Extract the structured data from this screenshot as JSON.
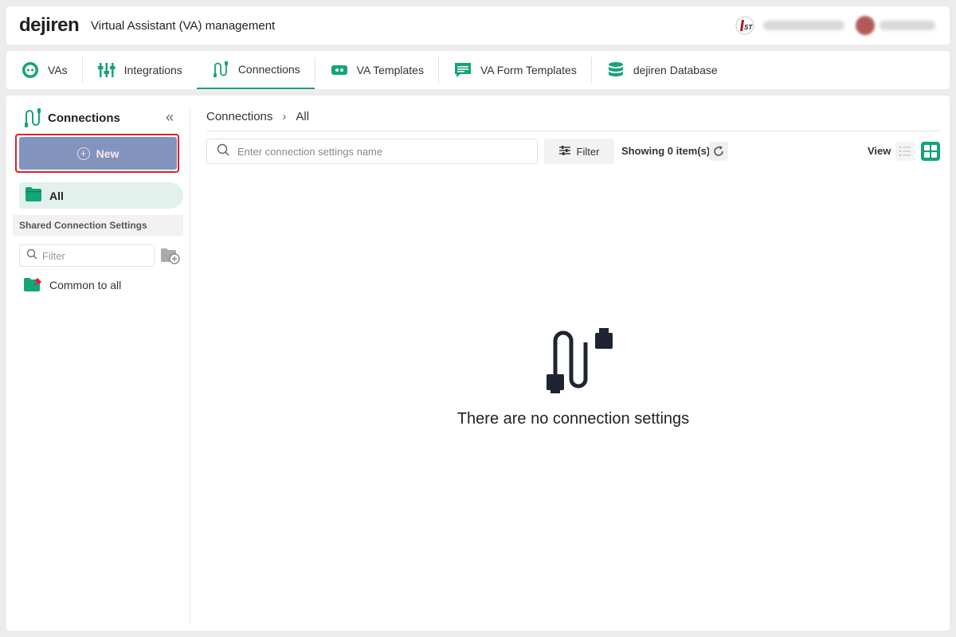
{
  "header": {
    "logo": "dejiren",
    "title": "Virtual Assistant (VA) management"
  },
  "tabs": [
    {
      "label": "VAs",
      "icon": "va-robot-icon"
    },
    {
      "label": "Integrations",
      "icon": "integrations-sliders-icon"
    },
    {
      "label": "Connections",
      "icon": "connections-cable-icon",
      "active": true
    },
    {
      "label": "VA Templates",
      "icon": "va-template-icon"
    },
    {
      "label": "VA Form Templates",
      "icon": "form-template-icon"
    },
    {
      "label": "dejiren Database",
      "icon": "database-icon"
    }
  ],
  "sidebar": {
    "title": "Connections",
    "new_label": "New",
    "all_label": "All",
    "shared_header": "Shared Connection Settings",
    "filter_placeholder": "Filter",
    "items": [
      {
        "label": "Common to all",
        "icon": "shared-folder-icon"
      }
    ]
  },
  "content": {
    "breadcrumb": [
      "Connections",
      "All"
    ],
    "breadcrumb_sep": "›",
    "search_placeholder": "Enter connection settings name",
    "filter_label": "Filter",
    "showing_text": "Showing 0 item(s)",
    "view_label": "View",
    "view_mode": "grid",
    "empty_message": "There are no connection settings"
  },
  "colors": {
    "accent": "#15a37a",
    "new_button": "#8293be",
    "highlight_border": "#e0202a"
  }
}
